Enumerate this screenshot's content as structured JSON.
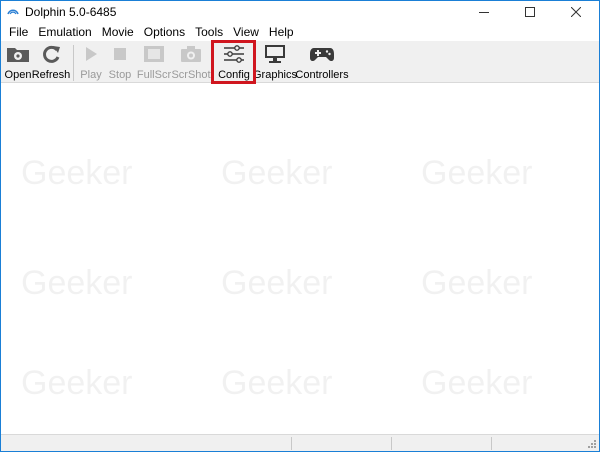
{
  "window": {
    "title": "Dolphin 5.0-6485"
  },
  "menu": [
    {
      "label": "File",
      "key": "file"
    },
    {
      "label": "Emulation",
      "key": "emulation"
    },
    {
      "label": "Movie",
      "key": "movie"
    },
    {
      "label": "Options",
      "key": "options"
    },
    {
      "label": "Tools",
      "key": "tools"
    },
    {
      "label": "View",
      "key": "view"
    },
    {
      "label": "Help",
      "key": "help"
    }
  ],
  "toolbar": {
    "open": {
      "label": "Open",
      "icon": "folder-icon",
      "enabled": true
    },
    "refresh": {
      "label": "Refresh",
      "icon": "refresh-icon",
      "enabled": true
    },
    "play": {
      "label": "Play",
      "icon": "play-icon",
      "enabled": false
    },
    "stop": {
      "label": "Stop",
      "icon": "stop-icon",
      "enabled": false
    },
    "fullscr": {
      "label": "FullScr",
      "icon": "fullscreen-icon",
      "enabled": false
    },
    "scrshot": {
      "label": "ScrShot",
      "icon": "camera-icon",
      "enabled": false
    },
    "config": {
      "label": "Config",
      "icon": "sliders-icon",
      "enabled": true,
      "highlighted": true
    },
    "graphics": {
      "label": "Graphics",
      "icon": "monitor-icon",
      "enabled": true
    },
    "controllers": {
      "label": "Controllers",
      "icon": "gamepad-icon",
      "enabled": true
    }
  },
  "watermark": {
    "text": "Geeker"
  },
  "colors": {
    "highlight": "#d0161f",
    "accent": "#1a7fd6"
  }
}
